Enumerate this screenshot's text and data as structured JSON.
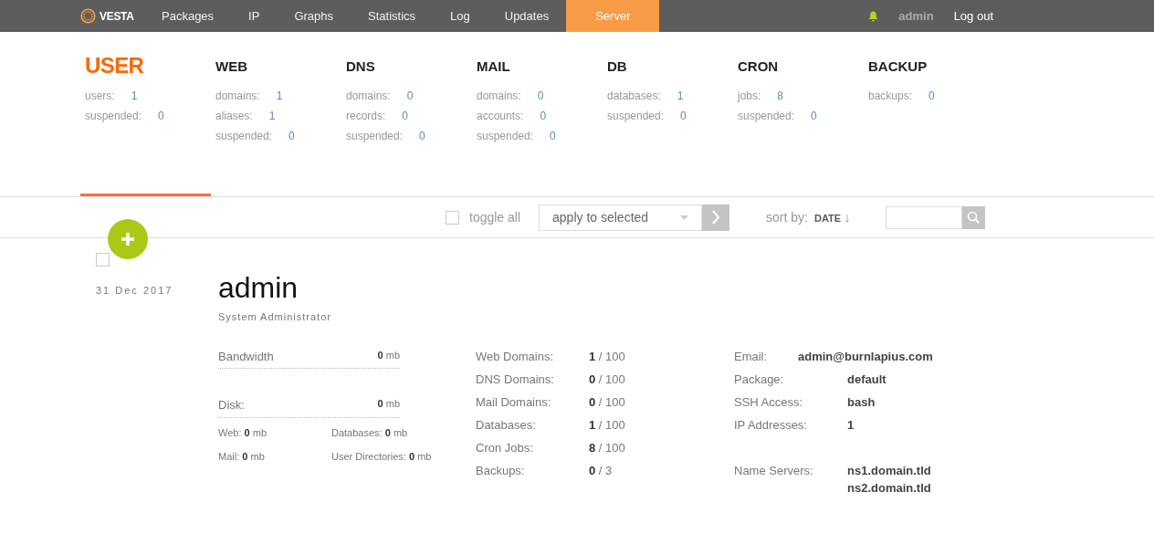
{
  "nav": {
    "logo": "VESTA",
    "items": [
      {
        "label": "Packages",
        "selected": false
      },
      {
        "label": "IP",
        "selected": false
      },
      {
        "label": "Graphs",
        "selected": false
      },
      {
        "label": "Statistics",
        "selected": false
      },
      {
        "label": "Log",
        "selected": false
      },
      {
        "label": "Updates",
        "selected": false
      },
      {
        "label": "Server",
        "selected": true
      }
    ],
    "user": "admin",
    "logout": "Log out"
  },
  "stats": [
    {
      "title": "USER",
      "selected": true,
      "rows": [
        {
          "label": "users:",
          "value": "1"
        },
        {
          "label": "suspended:",
          "value": "0"
        }
      ]
    },
    {
      "title": "WEB",
      "selected": false,
      "rows": [
        {
          "label": "domains:",
          "value": "1"
        },
        {
          "label": "aliases:",
          "value": "1"
        },
        {
          "label": "suspended:",
          "value": "0"
        }
      ]
    },
    {
      "title": "DNS",
      "selected": false,
      "rows": [
        {
          "label": "domains:",
          "value": "0"
        },
        {
          "label": "records:",
          "value": "0"
        },
        {
          "label": "suspended:",
          "value": "0"
        }
      ]
    },
    {
      "title": "MAIL",
      "selected": false,
      "rows": [
        {
          "label": "domains:",
          "value": "0"
        },
        {
          "label": "accounts:",
          "value": "0"
        },
        {
          "label": "suspended:",
          "value": "0"
        }
      ]
    },
    {
      "title": "DB",
      "selected": false,
      "rows": [
        {
          "label": "databases:",
          "value": "1"
        },
        {
          "label": "suspended:",
          "value": "0"
        }
      ]
    },
    {
      "title": "CRON",
      "selected": false,
      "rows": [
        {
          "label": "jobs:",
          "value": "8"
        },
        {
          "label": "suspended:",
          "value": "0"
        }
      ]
    },
    {
      "title": "BACKUP",
      "selected": false,
      "rows": [
        {
          "label": "backups:",
          "value": "0"
        }
      ]
    }
  ],
  "toolbar": {
    "toggle_all": {
      "label": "toggle all",
      "checked": false
    },
    "action": {
      "value": "apply to selected"
    },
    "sort": {
      "label": "sort by:",
      "value": "DATE",
      "arrow": "↓"
    }
  },
  "user": {
    "checked": false,
    "date": "31 Dec 2017",
    "name": "admin",
    "role": "System Administrator",
    "bandwidth": {
      "label": "Bandwidth",
      "value": "**0** mb"
    },
    "disk": {
      "label": "Disk:",
      "value": "**0** mb",
      "parts": [
        {
          "label": "Web: **0** mb"
        },
        {
          "label": "Databases: **0** mb"
        },
        {
          "label": "Mail: **0** mb"
        },
        {
          "label": "User Directories: **0** mb"
        }
      ]
    },
    "limits": [
      {
        "label": "Web Domains:",
        "value": "**1** / 100"
      },
      {
        "label": "DNS Domains:",
        "value": "**0** / 100"
      },
      {
        "label": "Mail Domains:",
        "value": "**0** / 100"
      },
      {
        "label": "Databases:",
        "value": "**1** / 100"
      },
      {
        "label": "Cron Jobs:",
        "value": "**8** / 100"
      },
      {
        "label": "Backups:",
        "value": "**0** / 3"
      }
    ],
    "details": [
      {
        "kind": "inline",
        "label": "Email:",
        "values": [
          "admin@burnlapius.com"
        ]
      },
      {
        "kind": "aligned",
        "label": "Package:",
        "values": [
          "default"
        ]
      },
      {
        "kind": "aligned",
        "label": "SSH Access:",
        "values": [
          "bash"
        ]
      },
      {
        "kind": "aligned",
        "label": "IP Addresses:",
        "values": [
          "1"
        ]
      },
      {
        "kind": "spacer"
      },
      {
        "kind": "aligned",
        "label": "Name Servers:",
        "values": [
          "ns1.domain.tld",
          "ns2.domain.tld"
        ]
      }
    ]
  }
}
